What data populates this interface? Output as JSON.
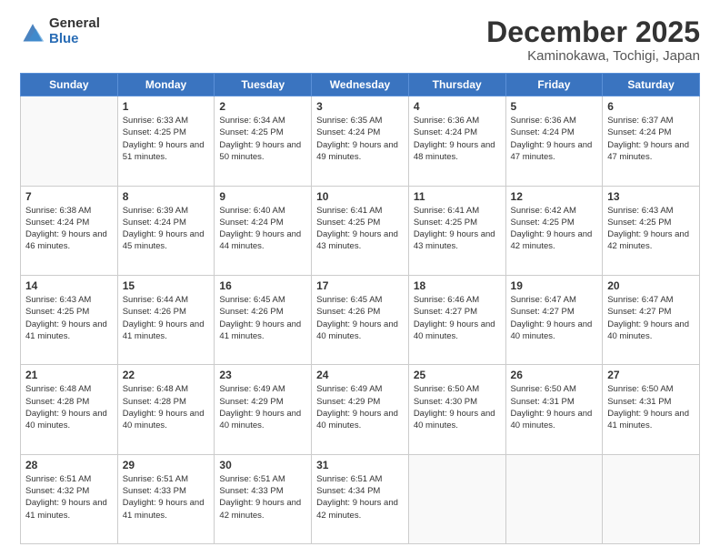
{
  "logo": {
    "general": "General",
    "blue": "Blue"
  },
  "header": {
    "title": "December 2025",
    "subtitle": "Kaminokawa, Tochigi, Japan"
  },
  "weekdays": [
    "Sunday",
    "Monday",
    "Tuesday",
    "Wednesday",
    "Thursday",
    "Friday",
    "Saturday"
  ],
  "weeks": [
    [
      {
        "day": "",
        "sunrise": "",
        "sunset": "",
        "daylight": ""
      },
      {
        "day": "1",
        "sunrise": "Sunrise: 6:33 AM",
        "sunset": "Sunset: 4:25 PM",
        "daylight": "Daylight: 9 hours and 51 minutes."
      },
      {
        "day": "2",
        "sunrise": "Sunrise: 6:34 AM",
        "sunset": "Sunset: 4:25 PM",
        "daylight": "Daylight: 9 hours and 50 minutes."
      },
      {
        "day": "3",
        "sunrise": "Sunrise: 6:35 AM",
        "sunset": "Sunset: 4:24 PM",
        "daylight": "Daylight: 9 hours and 49 minutes."
      },
      {
        "day": "4",
        "sunrise": "Sunrise: 6:36 AM",
        "sunset": "Sunset: 4:24 PM",
        "daylight": "Daylight: 9 hours and 48 minutes."
      },
      {
        "day": "5",
        "sunrise": "Sunrise: 6:36 AM",
        "sunset": "Sunset: 4:24 PM",
        "daylight": "Daylight: 9 hours and 47 minutes."
      },
      {
        "day": "6",
        "sunrise": "Sunrise: 6:37 AM",
        "sunset": "Sunset: 4:24 PM",
        "daylight": "Daylight: 9 hours and 47 minutes."
      }
    ],
    [
      {
        "day": "7",
        "sunrise": "Sunrise: 6:38 AM",
        "sunset": "Sunset: 4:24 PM",
        "daylight": "Daylight: 9 hours and 46 minutes."
      },
      {
        "day": "8",
        "sunrise": "Sunrise: 6:39 AM",
        "sunset": "Sunset: 4:24 PM",
        "daylight": "Daylight: 9 hours and 45 minutes."
      },
      {
        "day": "9",
        "sunrise": "Sunrise: 6:40 AM",
        "sunset": "Sunset: 4:24 PM",
        "daylight": "Daylight: 9 hours and 44 minutes."
      },
      {
        "day": "10",
        "sunrise": "Sunrise: 6:41 AM",
        "sunset": "Sunset: 4:25 PM",
        "daylight": "Daylight: 9 hours and 43 minutes."
      },
      {
        "day": "11",
        "sunrise": "Sunrise: 6:41 AM",
        "sunset": "Sunset: 4:25 PM",
        "daylight": "Daylight: 9 hours and 43 minutes."
      },
      {
        "day": "12",
        "sunrise": "Sunrise: 6:42 AM",
        "sunset": "Sunset: 4:25 PM",
        "daylight": "Daylight: 9 hours and 42 minutes."
      },
      {
        "day": "13",
        "sunrise": "Sunrise: 6:43 AM",
        "sunset": "Sunset: 4:25 PM",
        "daylight": "Daylight: 9 hours and 42 minutes."
      }
    ],
    [
      {
        "day": "14",
        "sunrise": "Sunrise: 6:43 AM",
        "sunset": "Sunset: 4:25 PM",
        "daylight": "Daylight: 9 hours and 41 minutes."
      },
      {
        "day": "15",
        "sunrise": "Sunrise: 6:44 AM",
        "sunset": "Sunset: 4:26 PM",
        "daylight": "Daylight: 9 hours and 41 minutes."
      },
      {
        "day": "16",
        "sunrise": "Sunrise: 6:45 AM",
        "sunset": "Sunset: 4:26 PM",
        "daylight": "Daylight: 9 hours and 41 minutes."
      },
      {
        "day": "17",
        "sunrise": "Sunrise: 6:45 AM",
        "sunset": "Sunset: 4:26 PM",
        "daylight": "Daylight: 9 hours and 40 minutes."
      },
      {
        "day": "18",
        "sunrise": "Sunrise: 6:46 AM",
        "sunset": "Sunset: 4:27 PM",
        "daylight": "Daylight: 9 hours and 40 minutes."
      },
      {
        "day": "19",
        "sunrise": "Sunrise: 6:47 AM",
        "sunset": "Sunset: 4:27 PM",
        "daylight": "Daylight: 9 hours and 40 minutes."
      },
      {
        "day": "20",
        "sunrise": "Sunrise: 6:47 AM",
        "sunset": "Sunset: 4:27 PM",
        "daylight": "Daylight: 9 hours and 40 minutes."
      }
    ],
    [
      {
        "day": "21",
        "sunrise": "Sunrise: 6:48 AM",
        "sunset": "Sunset: 4:28 PM",
        "daylight": "Daylight: 9 hours and 40 minutes."
      },
      {
        "day": "22",
        "sunrise": "Sunrise: 6:48 AM",
        "sunset": "Sunset: 4:28 PM",
        "daylight": "Daylight: 9 hours and 40 minutes."
      },
      {
        "day": "23",
        "sunrise": "Sunrise: 6:49 AM",
        "sunset": "Sunset: 4:29 PM",
        "daylight": "Daylight: 9 hours and 40 minutes."
      },
      {
        "day": "24",
        "sunrise": "Sunrise: 6:49 AM",
        "sunset": "Sunset: 4:29 PM",
        "daylight": "Daylight: 9 hours and 40 minutes."
      },
      {
        "day": "25",
        "sunrise": "Sunrise: 6:50 AM",
        "sunset": "Sunset: 4:30 PM",
        "daylight": "Daylight: 9 hours and 40 minutes."
      },
      {
        "day": "26",
        "sunrise": "Sunrise: 6:50 AM",
        "sunset": "Sunset: 4:31 PM",
        "daylight": "Daylight: 9 hours and 40 minutes."
      },
      {
        "day": "27",
        "sunrise": "Sunrise: 6:50 AM",
        "sunset": "Sunset: 4:31 PM",
        "daylight": "Daylight: 9 hours and 41 minutes."
      }
    ],
    [
      {
        "day": "28",
        "sunrise": "Sunrise: 6:51 AM",
        "sunset": "Sunset: 4:32 PM",
        "daylight": "Daylight: 9 hours and 41 minutes."
      },
      {
        "day": "29",
        "sunrise": "Sunrise: 6:51 AM",
        "sunset": "Sunset: 4:33 PM",
        "daylight": "Daylight: 9 hours and 41 minutes."
      },
      {
        "day": "30",
        "sunrise": "Sunrise: 6:51 AM",
        "sunset": "Sunset: 4:33 PM",
        "daylight": "Daylight: 9 hours and 42 minutes."
      },
      {
        "day": "31",
        "sunrise": "Sunrise: 6:51 AM",
        "sunset": "Sunset: 4:34 PM",
        "daylight": "Daylight: 9 hours and 42 minutes."
      },
      {
        "day": "",
        "sunrise": "",
        "sunset": "",
        "daylight": ""
      },
      {
        "day": "",
        "sunrise": "",
        "sunset": "",
        "daylight": ""
      },
      {
        "day": "",
        "sunrise": "",
        "sunset": "",
        "daylight": ""
      }
    ]
  ]
}
